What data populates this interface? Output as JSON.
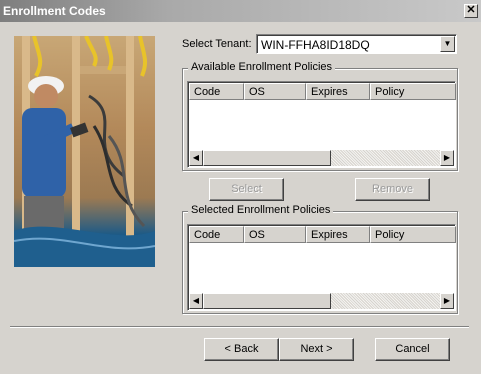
{
  "window": {
    "title": "Enrollment Codes",
    "close_glyph": "✕"
  },
  "tenant": {
    "label": "Select Tenant:",
    "value": "WIN-FFHA8ID18DQ"
  },
  "available": {
    "title": "Available Enrollment Policies",
    "columns": [
      "Code",
      "OS",
      "Expires",
      "Policy"
    ]
  },
  "actions": {
    "select_label": "Select",
    "remove_label": "Remove"
  },
  "selected": {
    "title": "Selected Enrollment Policies",
    "columns": [
      "Code",
      "OS",
      "Expires",
      "Policy"
    ]
  },
  "footer": {
    "back_label": "< Back",
    "next_label": "Next >",
    "cancel_label": "Cancel"
  },
  "icons": {
    "scroll_left": "◀",
    "scroll_right": "▶",
    "dropdown": "▼"
  }
}
